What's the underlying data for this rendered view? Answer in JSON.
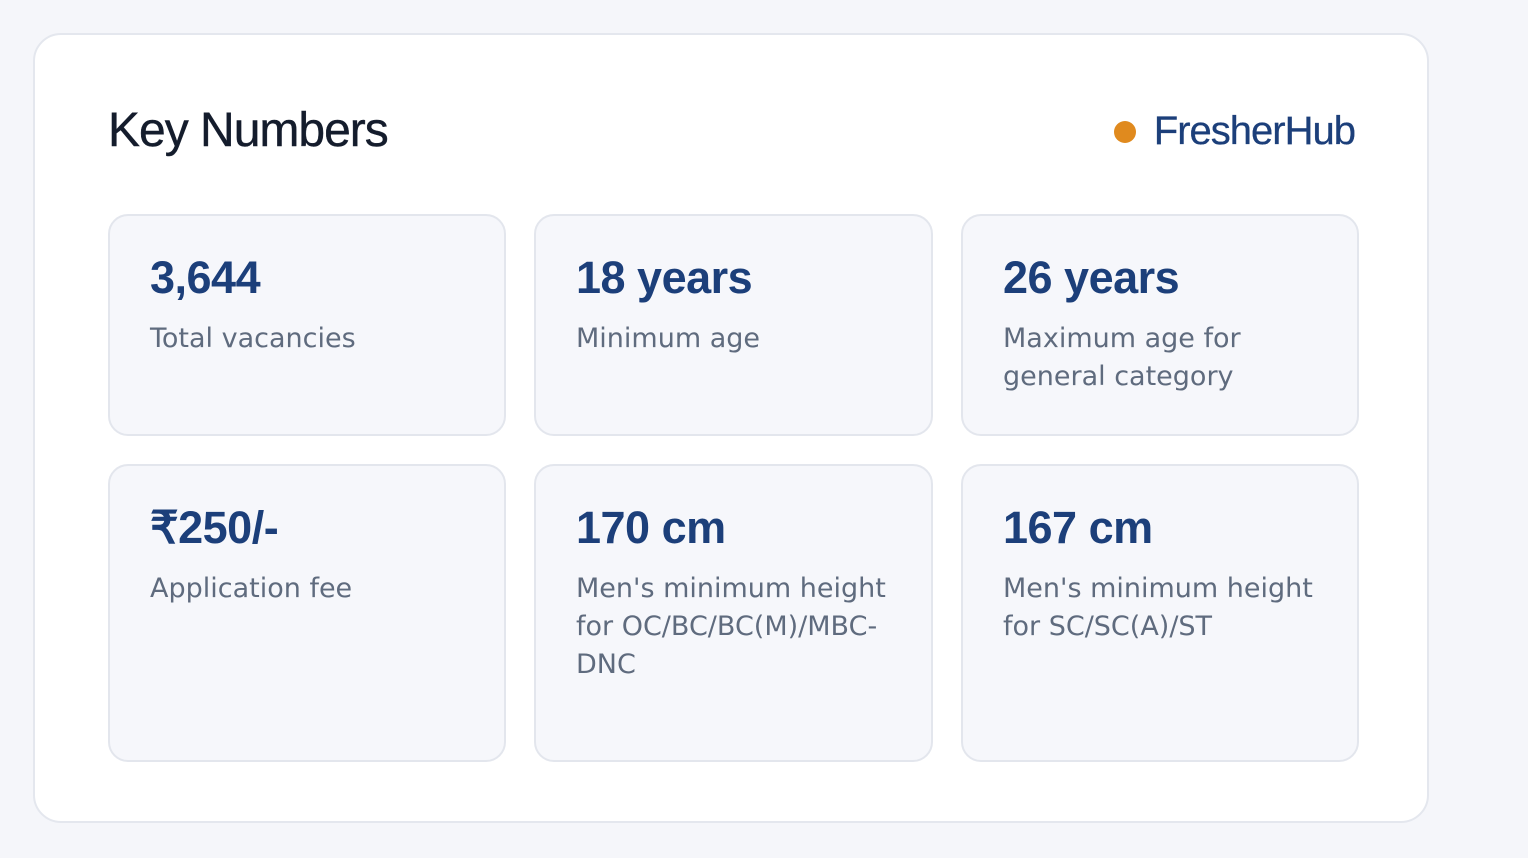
{
  "section": {
    "title": "Key Numbers",
    "brand": "FresherHub",
    "brand_dot_color": "#e08a1e",
    "accent_color": "#1c3f7a"
  },
  "cards": [
    {
      "value": "3,644",
      "label": "Total vacancies"
    },
    {
      "value": "18 years",
      "label": "Minimum age"
    },
    {
      "value": "26 years",
      "label": "Maximum age for general category"
    },
    {
      "value": "₹250/-",
      "label": "Application fee"
    },
    {
      "value": "170 cm",
      "label": "Men's minimum height for OC/BC/BC(M)/MBC-DNC"
    },
    {
      "value": "167 cm",
      "label": "Men's minimum height for SC/SC(A)/ST"
    }
  ]
}
